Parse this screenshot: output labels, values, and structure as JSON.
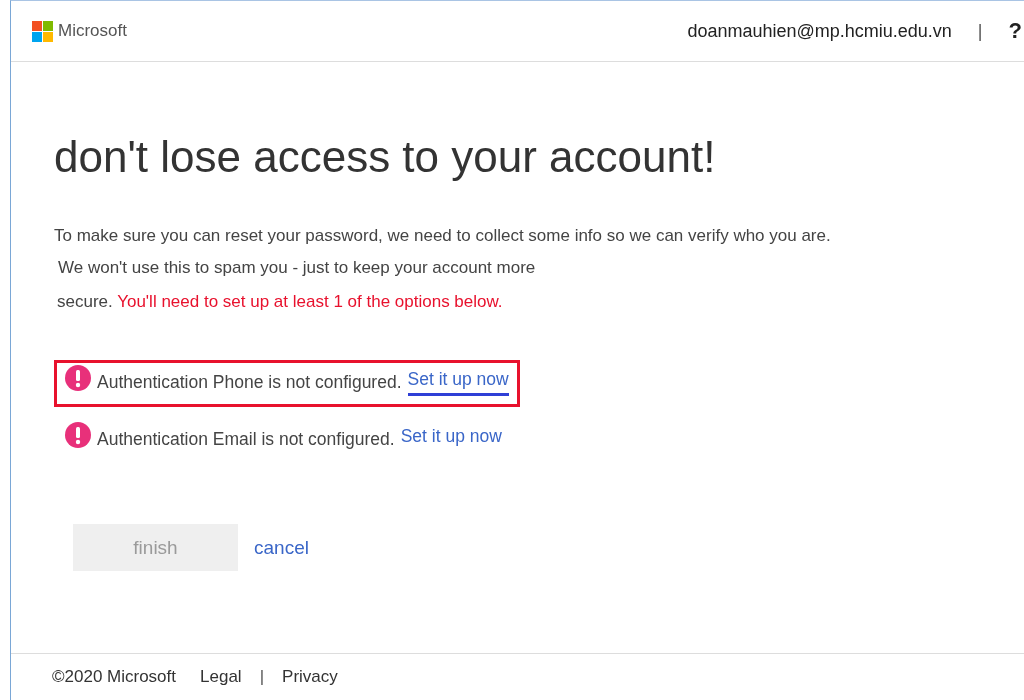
{
  "header": {
    "logo_text": "Microsoft",
    "account": "doanmauhien@mp.hcmiu.edu.vn",
    "separator": "|",
    "help": "?"
  },
  "title": "don't lose access to your account!",
  "intro_lines": [
    "To make sure you can reset your password, we need to collect some info so we can verify who you are.",
    "We won't use this to spam you - just to keep your account more"
  ],
  "requirement": {
    "lead": "secure.",
    "warning": "You'll need to set up at least 1 of the options below."
  },
  "methods": [
    {
      "text": "Authentication Phone is not configured.",
      "link": "Set it up now",
      "highlighted": true
    },
    {
      "text": "Authentication Email is not configured.",
      "link": "Set it up now",
      "highlighted": false
    }
  ],
  "buttons": {
    "finish": {
      "label": "finish",
      "disabled": true
    },
    "cancel": "cancel"
  },
  "footer": {
    "copyright": "©2020 Microsoft",
    "links": [
      "Legal",
      "Privacy"
    ],
    "separator": "|"
  }
}
